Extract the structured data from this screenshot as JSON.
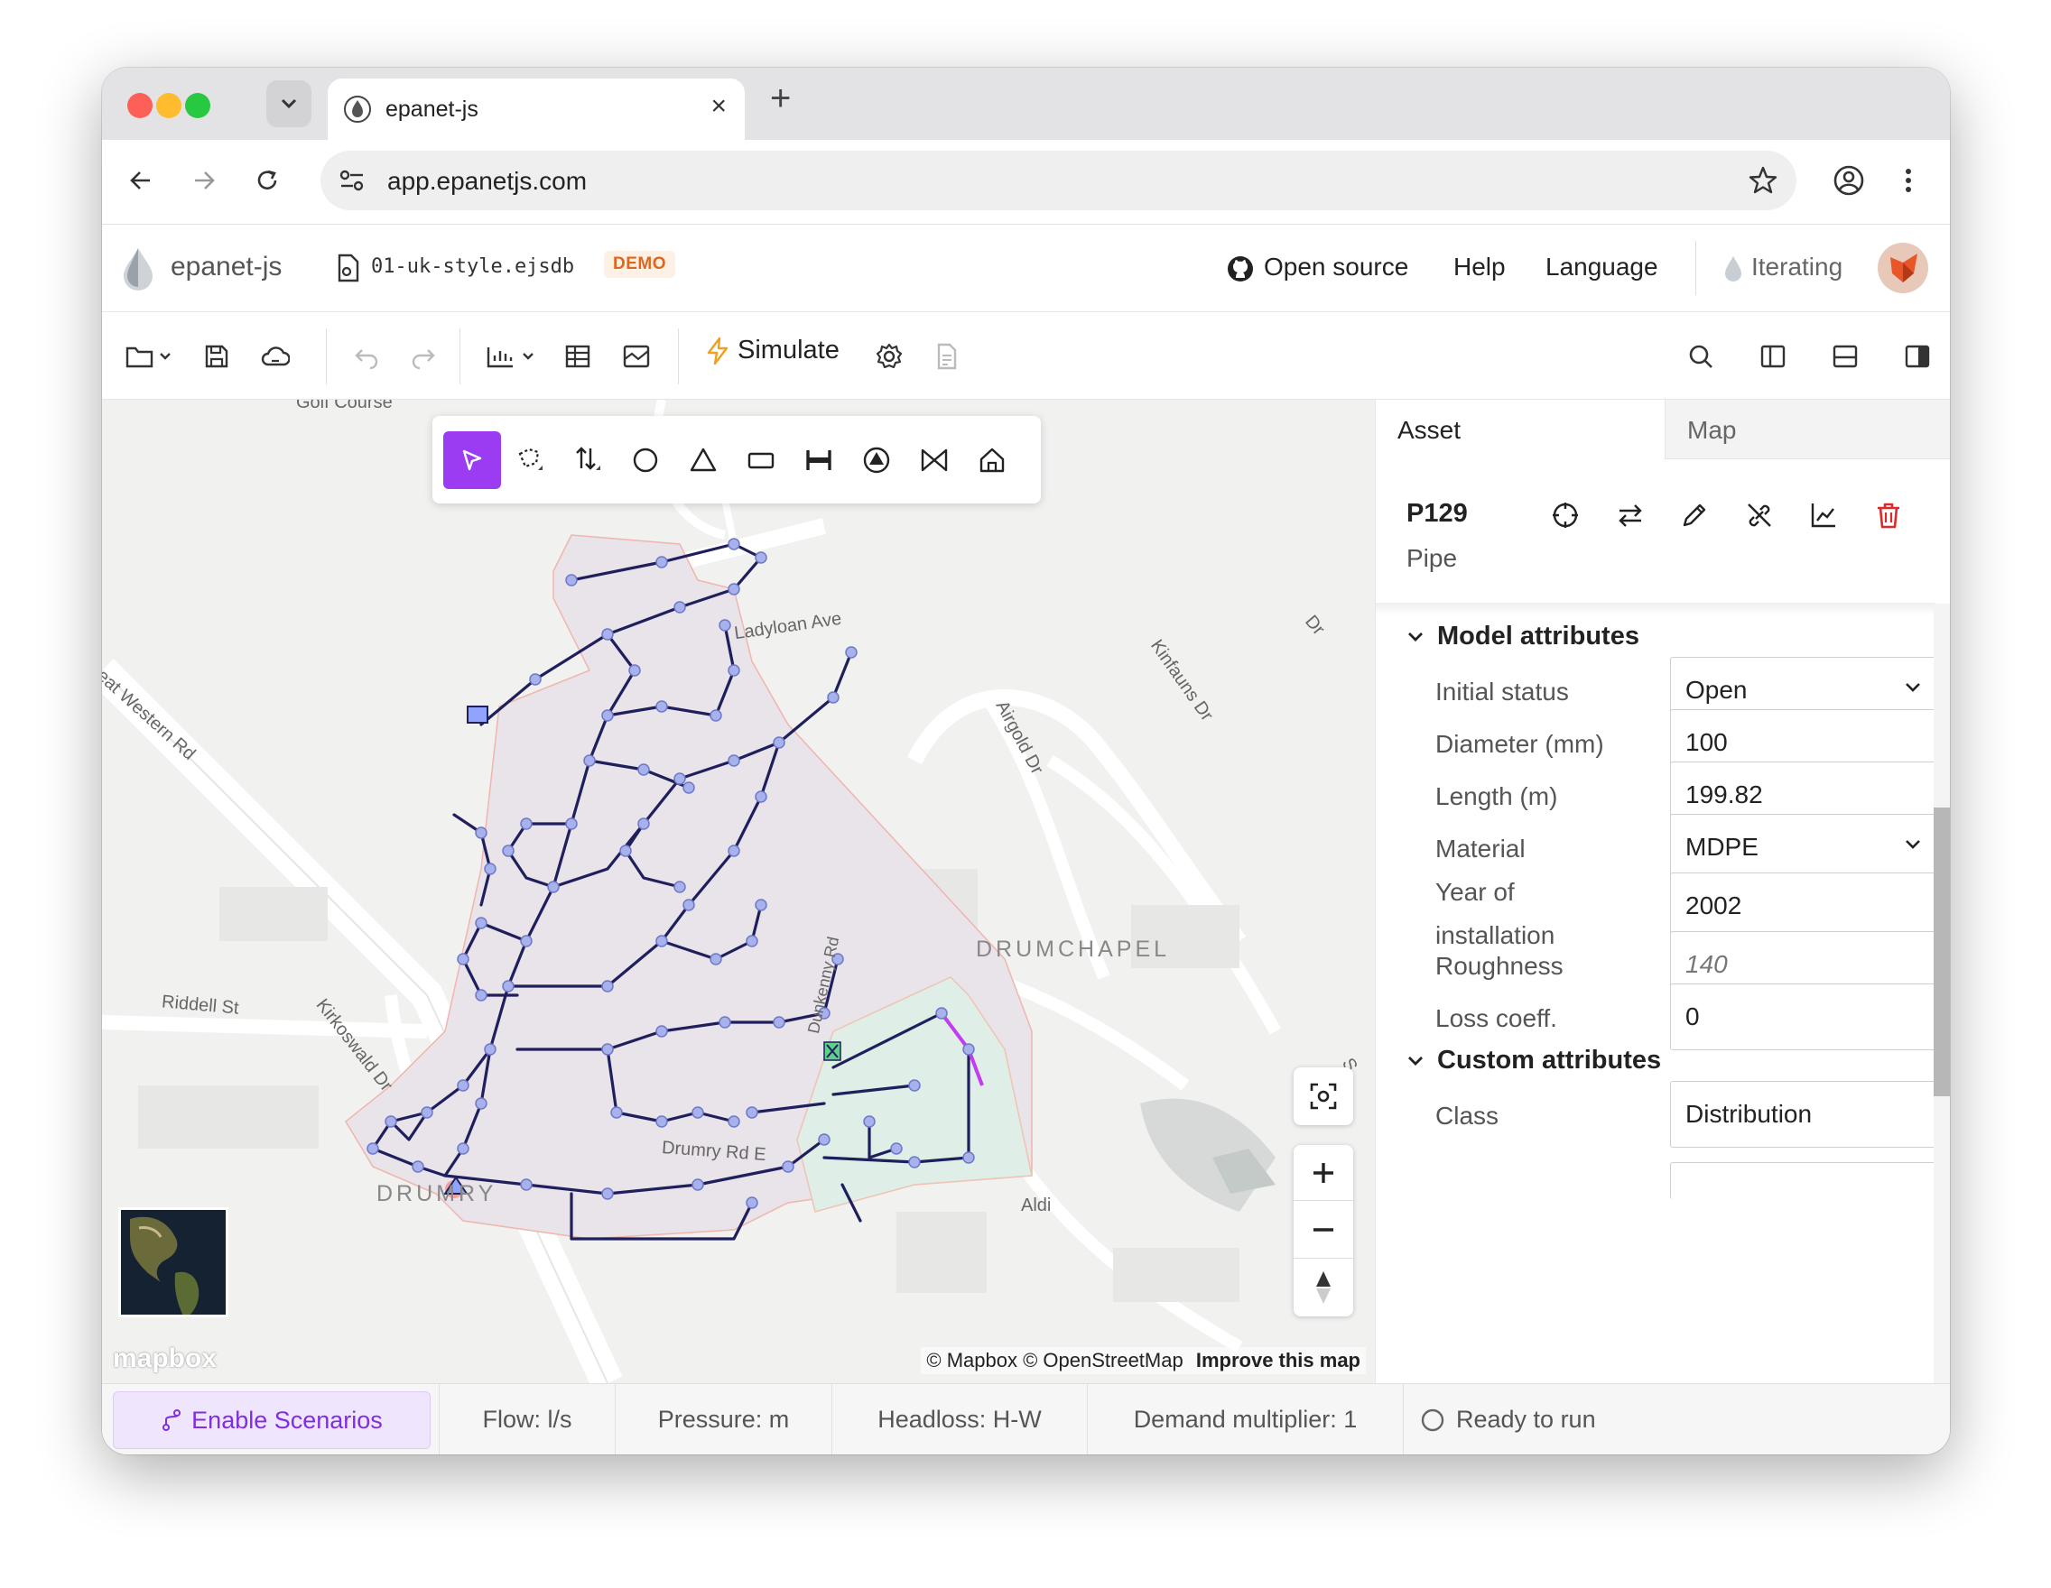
{
  "browser": {
    "tab_title": "epanet-js",
    "url": "app.epanetjs.com"
  },
  "app": {
    "brand": "epanet-js",
    "file_name": "01-uk-style.ejsdb",
    "file_badge": "DEMO",
    "header_links": {
      "open_source": "Open source",
      "help": "Help",
      "language": "Language"
    },
    "status": "Iterating"
  },
  "toolbar": {
    "simulate_label": "Simulate"
  },
  "map": {
    "labels": {
      "golf": "Golf Course",
      "dyloan": "Ladyloan Ave",
      "great_western": "Great Western Rd",
      "airgold": "Airgold Dr",
      "kinfauns": "Kinfauns Dr",
      "drumchapel": "DRUMCHAPEL",
      "dunkenny": "Dunkenny Rd",
      "riddell": "Riddell St",
      "kirkoswald": "Kirkoswald Dr",
      "drumry_rd": "Drumry Rd E",
      "drumry": "DRUMRY",
      "aldi": "Aldi",
      "dr": "Dr",
      "s": "S"
    },
    "attribution": "© Mapbox © OpenStreetMap",
    "improve": "Improve this map",
    "logo": "mapbox"
  },
  "panel": {
    "tabs": [
      "Asset",
      "Map"
    ],
    "asset_id": "P129",
    "asset_type": "Pipe",
    "model_section": "Model attributes",
    "custom_section": "Custom attributes",
    "fields": {
      "initial_status": {
        "label": "Initial status",
        "value": "Open"
      },
      "diameter": {
        "label": "Diameter (mm)",
        "value": "100"
      },
      "length": {
        "label": "Length (m)",
        "value": "199.82"
      },
      "material": {
        "label": "Material",
        "value": "MDPE"
      },
      "year": {
        "label": "Year of installation",
        "value": "2002"
      },
      "roughness": {
        "label": "Roughness",
        "placeholder": "140"
      },
      "loss": {
        "label": "Loss coeff.",
        "value": "0"
      },
      "class": {
        "label": "Class",
        "value": "Distribution"
      }
    }
  },
  "statusbar": {
    "enable_scenarios": "Enable Scenarios",
    "flow": "Flow: l/s",
    "pressure": "Pressure: m",
    "headloss": "Headloss: H-W",
    "demand": "Demand multiplier: 1",
    "run_state": "Ready to run"
  },
  "colors": {
    "accent": "#9b3cf3",
    "pipe": "#1e1f5c",
    "node": "#a7b1ec",
    "zone_a": "#e9e3ea",
    "zone_b": "#dfeee6",
    "selected_pipe": "#c43cf0",
    "delete": "#d92b2b",
    "demo_badge": "#e0661c"
  }
}
